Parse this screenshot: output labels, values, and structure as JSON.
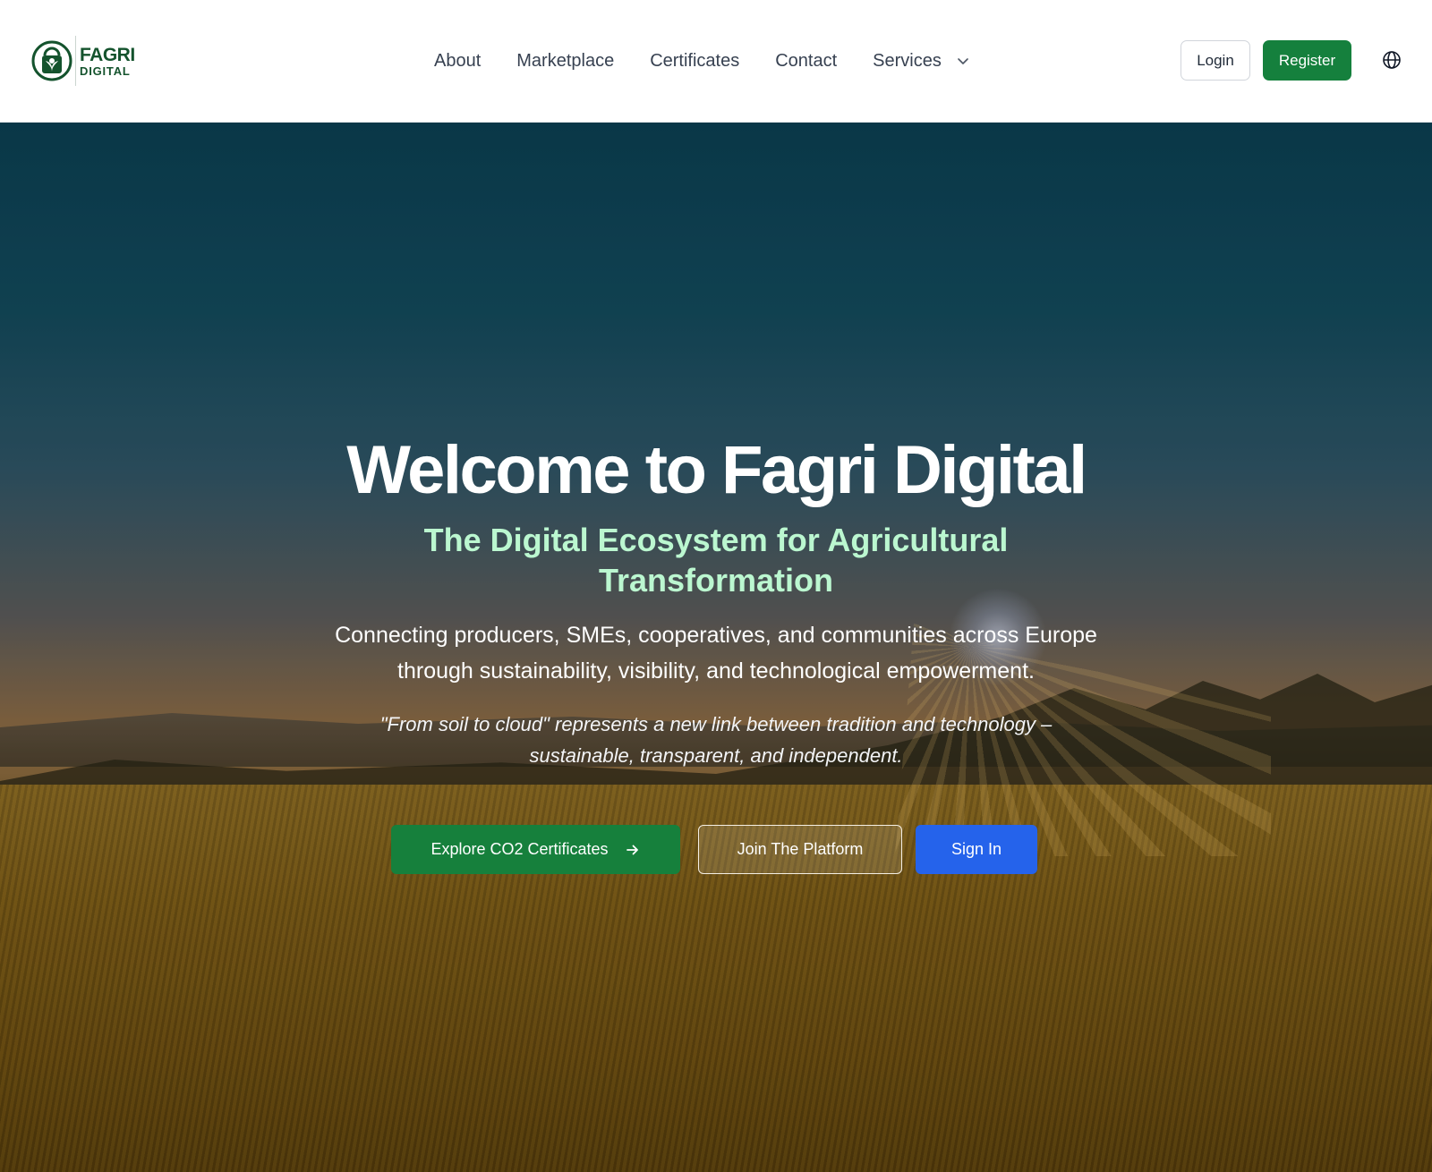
{
  "header": {
    "logo": {
      "line1": "FAGRI",
      "line2": "DIGITAL"
    },
    "nav": {
      "about": "About",
      "marketplace": "Marketplace",
      "certificates": "Certificates",
      "contact": "Contact",
      "services": "Services"
    },
    "login_label": "Login",
    "register_label": "Register",
    "icons": {
      "services_dropdown": "chevron-down-icon",
      "language": "globe-icon"
    }
  },
  "hero": {
    "title": "Welcome to Fagri Digital",
    "subtitle": "The Digital Ecosystem for Agricultural Transformation",
    "description": "Connecting producers, SMEs, cooperatives, and communities across Europe through sustainability, visibility, and technological empowerment.",
    "quote": "\"From soil to cloud\" represents a new link between tradition and technology – sustainable, transparent, and independent.",
    "buttons": {
      "explore": "Explore CO2 Certificates",
      "join": "Join The Platform",
      "signin": "Sign In"
    }
  },
  "colors": {
    "brand_green": "#15803d",
    "subtitle_green": "#bbf7d0",
    "signin_blue": "#2563eb",
    "logo_text": "#14532d"
  }
}
